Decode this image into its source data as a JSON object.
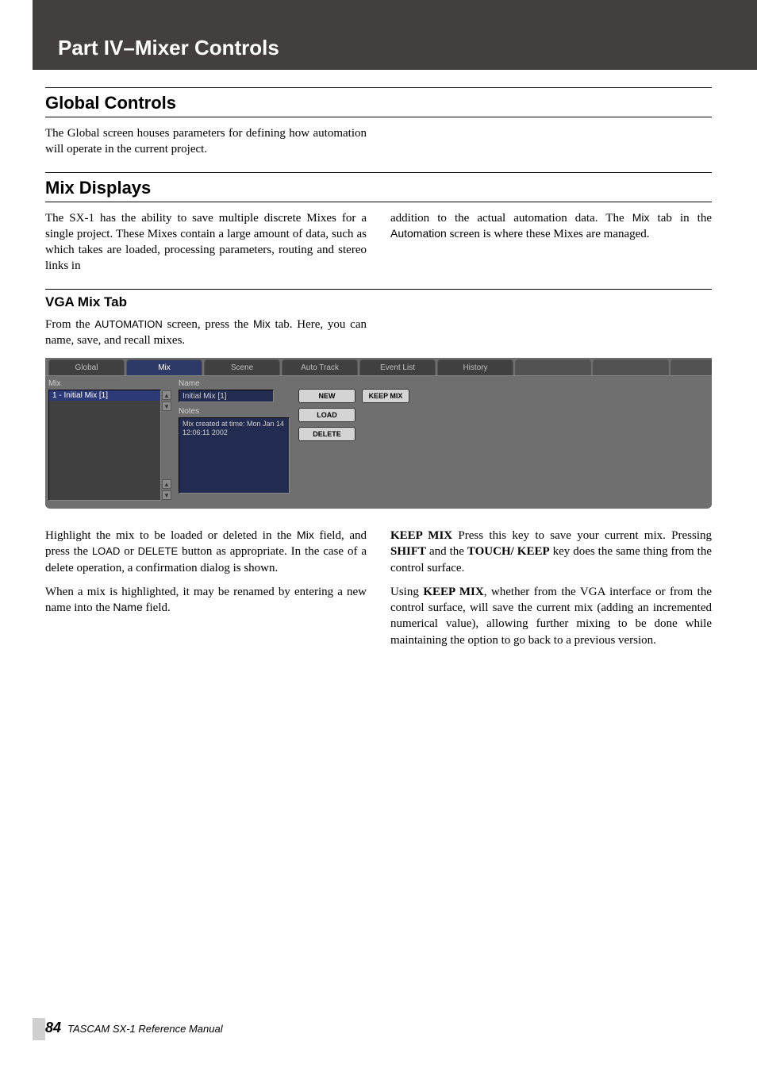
{
  "header": {
    "title": "Part IV–Mixer Controls"
  },
  "section1": {
    "heading": "Global Controls",
    "para": "The Global screen houses parameters for defining how automation will operate in the current project."
  },
  "section2": {
    "heading": "Mix Displays",
    "left": "The SX-1 has the ability to save multiple discrete Mixes for a single project. These Mixes contain a large amount of data, such as which takes are loaded, processing parameters, routing and stereo links in",
    "right_a": "addition to the actual automation data. The ",
    "right_b": " tab in the ",
    "right_c": " screen is where these Mixes are managed.",
    "mix_word": "Mix",
    "automation_word": "Automation"
  },
  "section3": {
    "heading": "VGA Mix Tab",
    "intro_a": "From the ",
    "intro_b": " screen, press the ",
    "intro_c": " tab. Here, you can name, save, and recall mixes.",
    "automation_caps": "AUTOMATION",
    "mix_word": "Mix"
  },
  "ui": {
    "tabs": [
      "Global",
      "Mix",
      "Scene",
      "Auto Track",
      "Event List",
      "History"
    ],
    "mix_label": "Mix",
    "list_item": "1 - Initial Mix [1]",
    "name_label": "Name",
    "name_value": "Initial Mix [1]",
    "notes_label": "Notes",
    "notes_value": "Mix created at time: Mon Jan 14 12:06:11 2002",
    "btn_new": "NEW",
    "btn_load": "LOAD",
    "btn_delete": "DELETE",
    "btn_keep": "KEEP MIX"
  },
  "below": {
    "left_p1_a": "Highlight the mix to be loaded or deleted in the ",
    "left_p1_b": " field, and press the ",
    "left_p1_c": " or ",
    "left_p1_d": " button as appropriate. In the case of a delete operation, a confirmation dialog is shown.",
    "mix_word": "Mix",
    "load_word": "LOAD",
    "delete_word": "DELETE",
    "left_p2_a": "When a mix is highlighted, it may be renamed by entering a new name into the ",
    "left_p2_b": " field.",
    "name_word": "Name",
    "right_p1_lead": "KEEP MIX",
    "right_p1_a": " Press this key to save your current mix. Pressing ",
    "right_p1_shift": "SHIFT",
    "right_p1_b": " and the ",
    "right_p1_touch": "TOUCH/ KEEP",
    "right_p1_c": " key does the same thing from the control surface.",
    "right_p2_a": "Using ",
    "right_p2_keep": "KEEP MIX",
    "right_p2_b": ", whether from the VGA interface or from the control surface, will save the current mix (adding an incremented numerical value), allowing further mixing to be done while maintaining the option to go back to a previous version."
  },
  "footer": {
    "page": "84",
    "text": "TASCAM SX-1 Reference Manual"
  }
}
